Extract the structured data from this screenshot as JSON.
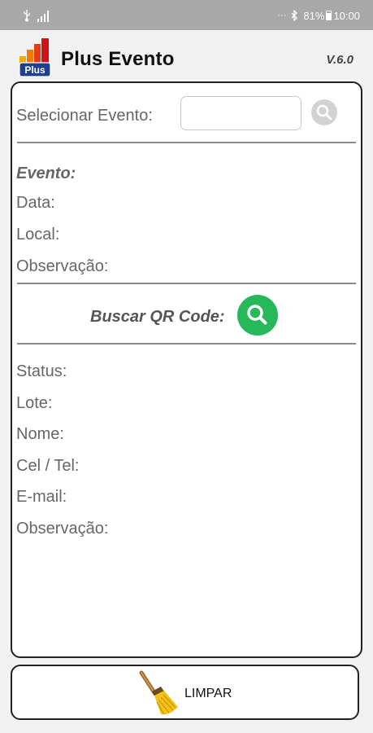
{
  "status_bar": {
    "overflow": "···",
    "battery": "81%",
    "time": "10:00"
  },
  "header": {
    "logo_text": "Plus",
    "title": "Plus Evento",
    "version": "V.6.0"
  },
  "event_section": {
    "select_label": "Selecionar Evento:",
    "input_value": "",
    "evento_label": "Evento:",
    "data_label": "Data:",
    "local_label": "Local:",
    "observacao_label": "Observação:"
  },
  "qr_section": {
    "label": "Buscar QR Code:"
  },
  "ticket_section": {
    "status_label": "Status:",
    "lote_label": "Lote:",
    "nome_label": "Nome:",
    "cel_label": "Cel / Tel:",
    "email_label": "E-mail:",
    "observacao_label": "Observação:"
  },
  "footer": {
    "clear_label": "LIMPAR"
  },
  "colors": {
    "status_bar": "#a8a8a8",
    "qr_button": "#27b85b",
    "search_button": "#d2d2d2",
    "panel_border": "#222222"
  },
  "icons": [
    "usb-icon",
    "signal-icon",
    "bluetooth-icon",
    "battery-icon",
    "search-icon",
    "broom-icon"
  ]
}
